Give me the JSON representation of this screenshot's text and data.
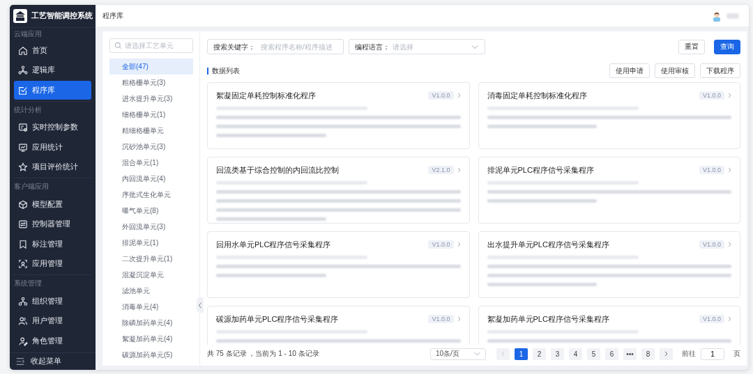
{
  "app": {
    "title": "工艺智能调控系统"
  },
  "sidebar": {
    "groups": [
      {
        "label": "云端应用",
        "items": [
          {
            "label": "首页",
            "selected": false
          },
          {
            "label": "逻辑库",
            "selected": false
          },
          {
            "label": "程序库",
            "selected": true
          }
        ]
      },
      {
        "label": "统计分析",
        "items": [
          {
            "label": "实时控制参数",
            "selected": false
          },
          {
            "label": "应用统计",
            "selected": false
          },
          {
            "label": "项目评价统计",
            "selected": false
          }
        ]
      },
      {
        "label": "客户端应用",
        "items": [
          {
            "label": "模型配置",
            "selected": false
          },
          {
            "label": "控制器管理",
            "selected": false
          },
          {
            "label": "标注管理",
            "selected": false
          },
          {
            "label": "应用管理",
            "selected": false
          }
        ]
      },
      {
        "label": "系统管理",
        "items": [
          {
            "label": "组织管理",
            "selected": false
          },
          {
            "label": "用户管理",
            "selected": false
          },
          {
            "label": "角色管理",
            "selected": false
          }
        ]
      }
    ],
    "collapse": "收起菜单"
  },
  "header": {
    "breadcrumb": "程序库"
  },
  "tree": {
    "placeholder": "请选择工艺单元",
    "items": [
      {
        "label": "全部(47)",
        "selected": true
      },
      {
        "label": "粗格栅单元(3)",
        "selected": false
      },
      {
        "label": "进水提升单元(3)",
        "selected": false
      },
      {
        "label": "细格栅单元(1)",
        "selected": false
      },
      {
        "label": "精细格栅单元",
        "selected": false
      },
      {
        "label": "沉砂池单元(3)",
        "selected": false
      },
      {
        "label": "混合单元(1)",
        "selected": false
      },
      {
        "label": "内回流单元(4)",
        "selected": false
      },
      {
        "label": "序批式生化单元",
        "selected": false
      },
      {
        "label": "曝气单元(8)",
        "selected": false
      },
      {
        "label": "外回流单元(3)",
        "selected": false
      },
      {
        "label": "排泥单元(1)",
        "selected": false
      },
      {
        "label": "二次提升单元(1)",
        "selected": false
      },
      {
        "label": "混凝沉淀单元",
        "selected": false
      },
      {
        "label": "滤池单元",
        "selected": false
      },
      {
        "label": "消毒单元(4)",
        "selected": false
      },
      {
        "label": "除磷加药单元(4)",
        "selected": false
      },
      {
        "label": "絮凝加药单元(4)",
        "selected": false
      },
      {
        "label": "碳源加药单元(5)",
        "selected": false
      }
    ]
  },
  "filters": [
    {
      "kind": "text",
      "label": "搜索关键字：",
      "placeholder": "搜索程序名称/程序描述"
    },
    {
      "kind": "select",
      "label": "编程语言：",
      "placeholder": "请选择"
    }
  ],
  "filter_buttons": [
    {
      "label": "重置",
      "kind": "default"
    },
    {
      "label": "查询",
      "kind": "primary"
    }
  ],
  "list": {
    "title": "数据列表",
    "actions": [
      "使用申请",
      "使用审核",
      "下载程序"
    ]
  },
  "cards": [
    {
      "title": "絮凝固定单耗控制标准化程序",
      "version": "V1.0.0"
    },
    {
      "title": "消毒固定单耗控制标准化程序",
      "version": "V1.0.0"
    },
    {
      "title": "回流类基于综合控制的内回流比控制",
      "version": "V2.1.0"
    },
    {
      "title": "排泥单元PLC程序信号采集程序",
      "version": "V1.0.0"
    },
    {
      "title": "回用水单元PLC程序信号采集程序",
      "version": "V1.0.0"
    },
    {
      "title": "出水提升单元PLC程序信号采集程序",
      "version": "V1.0.0"
    },
    {
      "title": "碳源加药单元PLC程序信号采集程序",
      "version": "V1.0.0"
    },
    {
      "title": "絮凝加药单元PLC程序信号采集程序",
      "version": "V1.0.0"
    }
  ],
  "pagination": {
    "summary": "共 75 条记录 ，当前为 1 - 10 条记录",
    "page_size": "10条/页",
    "pages": [
      {
        "label": "1",
        "selected": true
      },
      {
        "label": "2",
        "selected": false
      },
      {
        "label": "3",
        "selected": false
      },
      {
        "label": "4",
        "selected": false
      },
      {
        "label": "5",
        "selected": false
      },
      {
        "label": "6",
        "selected": false
      },
      {
        "label": "•••",
        "selected": false
      },
      {
        "label": "8",
        "selected": false
      }
    ],
    "goto_label": "前往",
    "goto_value": "1",
    "page_label": "页"
  }
}
